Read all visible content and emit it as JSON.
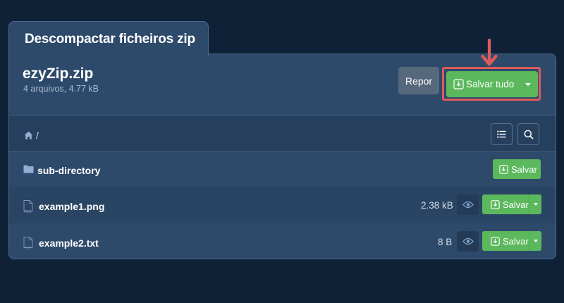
{
  "tab": {
    "title": "Descompactar ficheiros zip"
  },
  "archive": {
    "name": "ezyZip.zip",
    "meta": "4 arquivos, 4.77 kB"
  },
  "actions": {
    "reset_label": "Repor",
    "save_all_label": "Salvar tudo"
  },
  "breadcrumb": {
    "root_separator": "/"
  },
  "files": [
    {
      "name": "sub-directory",
      "type": "folder",
      "size": "",
      "save_label": "Salvar"
    },
    {
      "name": "example1.png",
      "type": "PNG",
      "size": "2.38 kB",
      "save_label": "Salvar"
    },
    {
      "name": "example2.txt",
      "type": "TXT",
      "size": "8 B",
      "save_label": "Salvar"
    }
  ],
  "colors": {
    "background": "#0f2136",
    "panel": "#2e4a6b",
    "accent_green": "#5cb85c",
    "highlight_red": "#e05a5a"
  },
  "icons": {
    "home": "home-icon",
    "list": "list-icon",
    "search": "search-icon",
    "folder": "folder-icon",
    "file": "file-icon",
    "eye": "eye-icon",
    "download": "download-icon",
    "arrow": "arrow-down-icon"
  }
}
